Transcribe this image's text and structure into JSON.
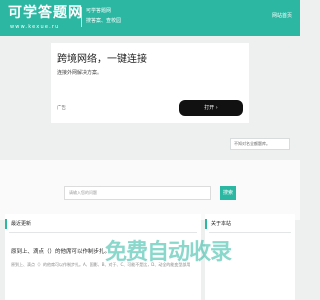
{
  "header": {
    "logo": "可学答题网",
    "logo_url": "www.kexue.ru",
    "tagline_1": "可学答题网",
    "tagline_2": "搜答案、查校园",
    "nav_link": "网站首页"
  },
  "ad": {
    "title": "跨境网络，一键连接",
    "subtitle": "连接外网解决方案。",
    "label": "广告",
    "button": "打开 ›"
  },
  "search_top": {
    "placeholder": "不知对名全额题库。"
  },
  "search_main": {
    "placeholder": "请输入您的问题",
    "button": "搜索"
  },
  "recent": {
    "heading": "最近更新",
    "question_title": "原到上、滴点（）的他席可以作制步扎。",
    "question_desc": "原到上、滴点（）的他席可以作制步扎。A、国影、B、对于、C、可能不是比，D、动全的能变型部用"
  },
  "about": {
    "heading": "关于本站"
  },
  "watermark": {
    "text": "免费自动收录"
  },
  "colors": {
    "brand": "#2bb7a2",
    "ad_button": "#111111"
  }
}
